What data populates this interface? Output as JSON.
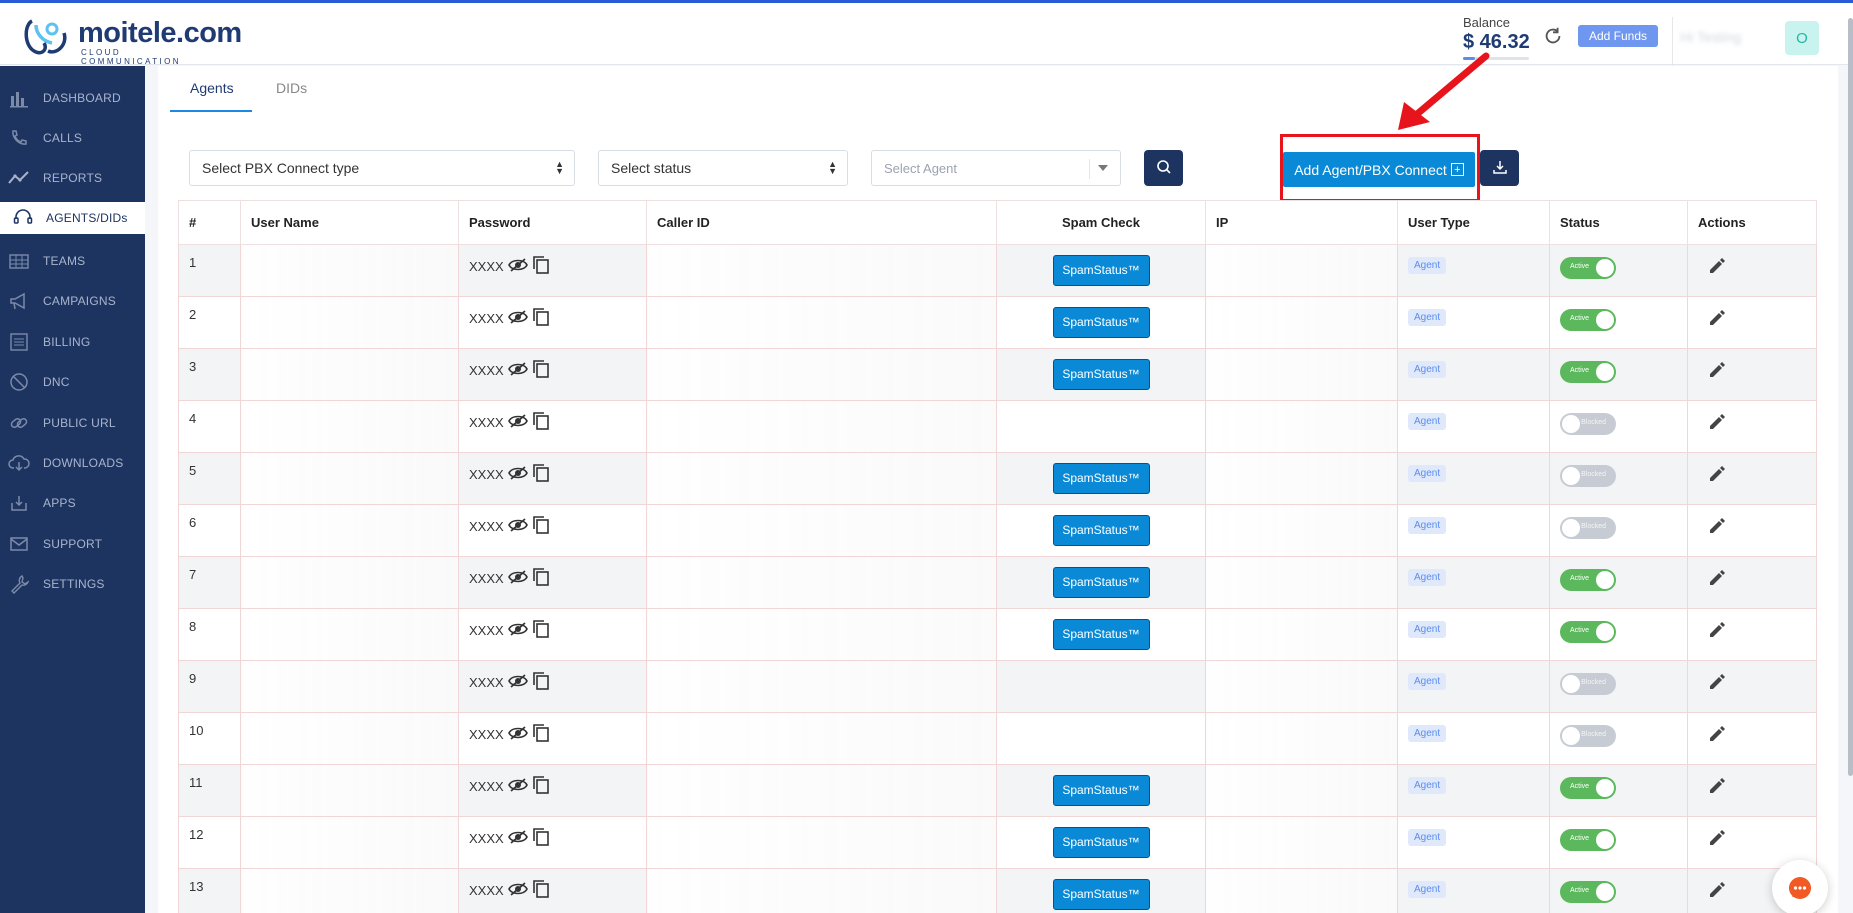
{
  "header": {
    "brand_name": "moitele.com",
    "brand_tagline": "CLOUD COMMUNICATION",
    "balance_label": "Balance",
    "balance_value": "$ 46.32",
    "add_funds_label": "Add Funds",
    "avatar_initial": "O",
    "user_name": "Hi Testing"
  },
  "sidebar": {
    "items": [
      {
        "label": "DASHBOARD",
        "icon": "dashboard-icon"
      },
      {
        "label": "CALLS",
        "icon": "phone-icon"
      },
      {
        "label": "REPORTS",
        "icon": "chart-icon"
      },
      {
        "label": "AGENTS/DIDs",
        "icon": "headset-icon",
        "active": true
      },
      {
        "label": "TEAMS",
        "icon": "team-icon"
      },
      {
        "label": "CAMPAIGNS",
        "icon": "megaphone-icon"
      },
      {
        "label": "BILLING",
        "icon": "billing-icon"
      },
      {
        "label": "DNC",
        "icon": "block-icon"
      },
      {
        "label": "PUBLIC URL",
        "icon": "link-icon"
      },
      {
        "label": "DOWNLOADS",
        "icon": "cloud-download-icon"
      },
      {
        "label": "APPS",
        "icon": "apps-icon"
      },
      {
        "label": "SUPPORT",
        "icon": "mail-icon"
      },
      {
        "label": "SETTINGS",
        "icon": "wrench-icon"
      }
    ]
  },
  "tabs": [
    {
      "label": "Agents",
      "active": true
    },
    {
      "label": "DIDs",
      "active": false
    }
  ],
  "filters": {
    "pbx_type": "Select PBX Connect type",
    "status": "Select status",
    "agent_placeholder": "Select Agent",
    "add_button": "Add Agent/PBX Connect"
  },
  "table": {
    "columns": [
      "#",
      "User Name",
      "Password",
      "Caller ID",
      "Spam Check",
      "IP",
      "User Type",
      "Status",
      "Actions"
    ],
    "rows": [
      {
        "num": "1",
        "password": "XXXX",
        "spam": "SpamStatus™",
        "type": "Agent",
        "status": "Active"
      },
      {
        "num": "2",
        "password": "XXXX",
        "spam": "SpamStatus™",
        "type": "Agent",
        "status": "Active"
      },
      {
        "num": "3",
        "password": "XXXX",
        "spam": "SpamStatus™",
        "type": "Agent",
        "status": "Active"
      },
      {
        "num": "4",
        "password": "XXXX",
        "spam": "",
        "type": "Agent",
        "status": "Blocked"
      },
      {
        "num": "5",
        "password": "XXXX",
        "spam": "SpamStatus™",
        "type": "Agent",
        "status": "Blocked"
      },
      {
        "num": "6",
        "password": "XXXX",
        "spam": "SpamStatus™",
        "type": "Agent",
        "status": "Blocked"
      },
      {
        "num": "7",
        "password": "XXXX",
        "spam": "SpamStatus™",
        "type": "Agent",
        "status": "Active"
      },
      {
        "num": "8",
        "password": "XXXX",
        "spam": "SpamStatus™",
        "type": "Agent",
        "status": "Active"
      },
      {
        "num": "9",
        "password": "XXXX",
        "spam": "",
        "type": "Agent",
        "status": "Blocked"
      },
      {
        "num": "10",
        "password": "XXXX",
        "spam": "",
        "type": "Agent",
        "status": "Blocked"
      },
      {
        "num": "11",
        "password": "XXXX",
        "spam": "SpamStatus™",
        "type": "Agent",
        "status": "Active"
      },
      {
        "num": "12",
        "password": "XXXX",
        "spam": "SpamStatus™",
        "type": "Agent",
        "status": "Active"
      },
      {
        "num": "13",
        "password": "XXXX",
        "spam": "SpamStatus™",
        "type": "Agent",
        "status": "Active"
      }
    ]
  },
  "colors": {
    "sidebar_bg": "#1d3461",
    "primary_button": "#0a8ad6",
    "highlight": "#e8141b",
    "active_toggle": "#5cb85c",
    "blocked_toggle": "#c7ccd4"
  }
}
